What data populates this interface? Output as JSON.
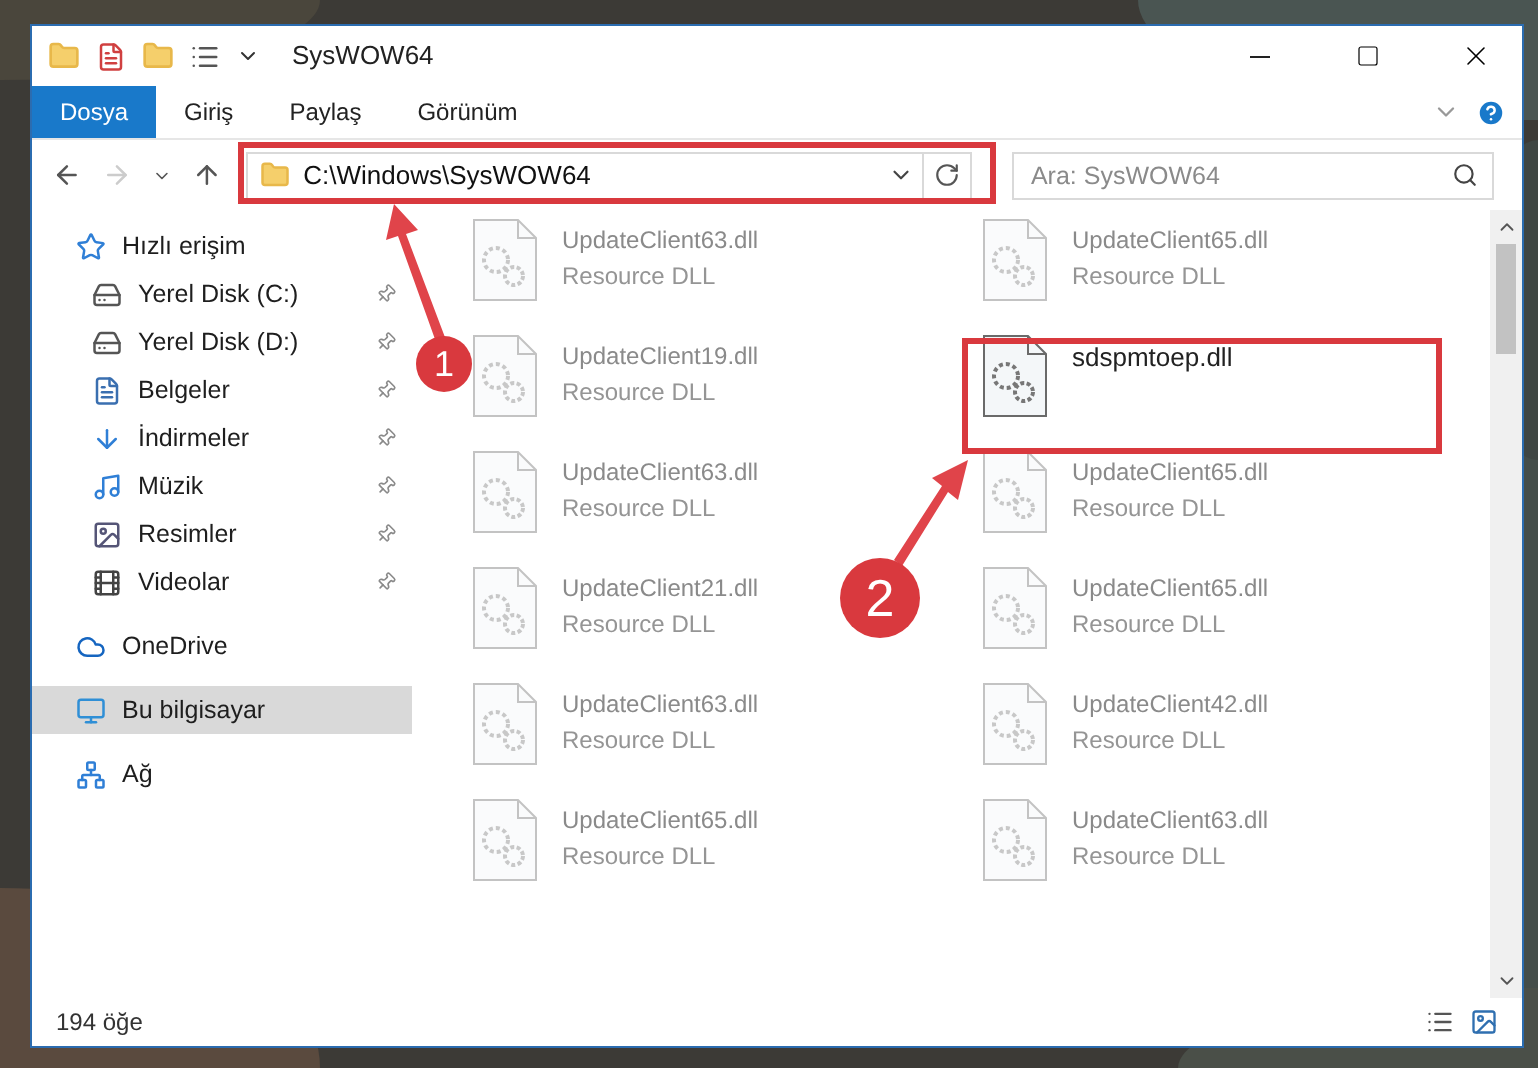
{
  "window": {
    "title": "SysWOW64"
  },
  "ribbon_tabs": [
    {
      "label": "Dosya",
      "selected": true
    },
    {
      "label": "Giriş",
      "selected": false
    },
    {
      "label": "Paylaş",
      "selected": false
    },
    {
      "label": "Görünüm",
      "selected": false
    }
  ],
  "address_bar": {
    "path": "C:\\Windows\\SysWOW64"
  },
  "search": {
    "placeholder": "Ara: SysWOW64"
  },
  "sidebar": {
    "items": [
      {
        "label": "Hızlı erişim",
        "selected": false,
        "children": [
          {
            "label": "Yerel Disk (C:)",
            "pinned": true,
            "selected": false
          },
          {
            "label": "Yerel Disk (D:)",
            "pinned": true,
            "selected": false
          },
          {
            "label": "Belgeler",
            "pinned": true,
            "selected": false
          },
          {
            "label": "İndirmeler",
            "pinned": true,
            "selected": false
          },
          {
            "label": "Müzik",
            "pinned": true,
            "selected": false
          },
          {
            "label": "Resimler",
            "pinned": true,
            "selected": false
          },
          {
            "label": "Videolar",
            "pinned": true,
            "selected": false
          }
        ]
      },
      {
        "label": "OneDrive",
        "selected": false
      },
      {
        "label": "Bu bilgisayar",
        "selected": true
      },
      {
        "label": "Ağ",
        "selected": false
      }
    ]
  },
  "files": [
    {
      "name": "UpdateClient63.dll",
      "type": "Resource DLL",
      "blurred": true
    },
    {
      "name": "UpdateClient65.dll",
      "type": "Resource DLL",
      "blurred": true
    },
    {
      "name": "UpdateClient19.dll",
      "type": "Resource DLL",
      "blurred": true
    },
    {
      "name": "sdspmtoep.dll",
      "blurred": false
    },
    {
      "name": "UpdateClient63.dll",
      "type": "Resource DLL",
      "blurred": true
    },
    {
      "name": "UpdateClient65.dll",
      "type": "Resource DLL",
      "blurred": true
    },
    {
      "name": "UpdateClient21.dll",
      "type": "Resource DLL",
      "blurred": true
    },
    {
      "name": "UpdateClient65.dll",
      "type": "Resource DLL",
      "blurred": true
    },
    {
      "name": "UpdateClient63.dll",
      "type": "Resource DLL",
      "blurred": true
    },
    {
      "name": "UpdateClient42.dll",
      "type": "Resource DLL",
      "blurred": true
    },
    {
      "name": "UpdateClient65.dll",
      "type": "Resource DLL",
      "blurred": true
    },
    {
      "name": "UpdateClient63.dll",
      "type": "Resource DLL",
      "blurred": true
    }
  ],
  "status_bar": {
    "item_count": "194 öğe"
  },
  "annotations": [
    {
      "number": "1"
    },
    {
      "number": "2"
    }
  ]
}
